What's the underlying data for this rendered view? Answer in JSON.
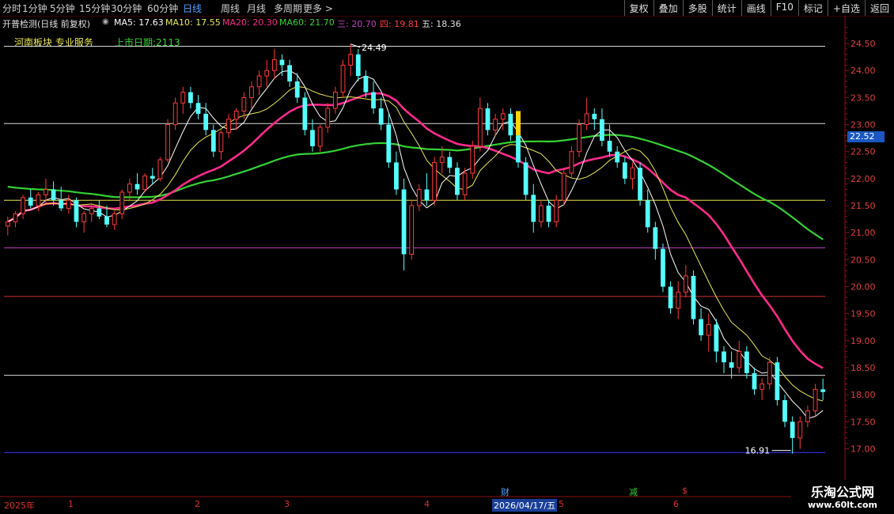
{
  "toolbar": {
    "timeframes": [
      "分时",
      "1分钟",
      "5分钟",
      "15分钟",
      "30分钟",
      "60分钟",
      "日线",
      "周线",
      "月线",
      "多周期",
      "更多 >"
    ],
    "active_timeframe": "日线",
    "right_buttons": [
      "复权",
      "叠加",
      "多股",
      "统计",
      "画线",
      "F10",
      "标记",
      "+自选",
      "返回"
    ]
  },
  "indicator_bar": {
    "name": "开普检测(日线 前复权)",
    "ma5": "MA5: 17.63",
    "ma10": "MA10: 17.55",
    "ma20": "MA20: 20.30",
    "ma60": "MA60: 21.70",
    "san": "三: 20.70",
    "si": "四: 19.81",
    "wu": "五: 18.36"
  },
  "sub_labels": {
    "sector": "河南板块 专业服务",
    "listing": "上市日期:2113"
  },
  "chart_data": {
    "type": "candlestick",
    "ylim": [
      16.7,
      24.75
    ],
    "y_ticks": [
      17.0,
      17.5,
      18.0,
      18.5,
      19.0,
      19.5,
      20.0,
      20.5,
      21.0,
      21.5,
      22.0,
      22.5,
      23.0,
      23.5,
      24.0,
      24.5
    ],
    "y_tick_labels": [
      "17.00",
      "17.50",
      "18.00",
      "18.50",
      "19.00",
      "19.50",
      "20.00",
      "20.50",
      "21.00",
      "21.50",
      "22.00",
      "22.50",
      "23.00",
      "23.50",
      "24.00",
      "24.50"
    ],
    "high_label": "24.49",
    "low_label": "16.91",
    "last_price_label": "22.52",
    "horizontal_lines": [
      {
        "value": 24.45,
        "color": "#d8d8d8"
      },
      {
        "value": 23.02,
        "color": "#d8d8d8"
      },
      {
        "value": 21.6,
        "color": "#e6e64a"
      },
      {
        "value": 20.72,
        "color": "#c040c0"
      },
      {
        "value": 19.82,
        "color": "#d03030"
      },
      {
        "value": 18.36,
        "color": "#d8d8d8"
      },
      {
        "value": 16.93,
        "color": "#3a3aff"
      }
    ],
    "ohlc": [
      [
        21.12,
        21.3,
        20.95,
        21.2
      ],
      [
        21.2,
        21.4,
        21.1,
        21.35
      ],
      [
        21.35,
        21.7,
        21.25,
        21.65
      ],
      [
        21.65,
        21.8,
        21.45,
        21.5
      ],
      [
        21.5,
        21.75,
        21.4,
        21.7
      ],
      [
        21.7,
        22.0,
        21.55,
        21.8
      ],
      [
        21.8,
        21.95,
        21.5,
        21.6
      ],
      [
        21.6,
        21.85,
        21.4,
        21.45
      ],
      [
        21.45,
        21.7,
        21.35,
        21.6
      ],
      [
        21.6,
        21.65,
        21.1,
        21.2
      ],
      [
        21.2,
        21.4,
        21.0,
        21.35
      ],
      [
        21.35,
        21.55,
        21.2,
        21.45
      ],
      [
        21.45,
        21.6,
        21.25,
        21.3
      ],
      [
        21.3,
        21.5,
        21.1,
        21.15
      ],
      [
        21.15,
        21.4,
        21.05,
        21.35
      ],
      [
        21.35,
        21.8,
        21.25,
        21.75
      ],
      [
        21.75,
        22.0,
        21.6,
        21.9
      ],
      [
        21.9,
        22.1,
        21.7,
        21.8
      ],
      [
        21.8,
        22.1,
        21.75,
        22.05
      ],
      [
        22.05,
        22.2,
        21.9,
        22.0
      ],
      [
        22.0,
        22.4,
        21.95,
        22.35
      ],
      [
        22.35,
        23.1,
        22.3,
        23.0
      ],
      [
        23.0,
        23.5,
        22.9,
        23.4
      ],
      [
        23.4,
        23.7,
        23.2,
        23.6
      ],
      [
        23.6,
        23.7,
        23.3,
        23.4
      ],
      [
        23.4,
        23.55,
        23.1,
        23.2
      ],
      [
        23.2,
        23.4,
        22.8,
        22.9
      ],
      [
        22.9,
        23.0,
        22.4,
        22.5
      ],
      [
        22.5,
        22.9,
        22.35,
        22.85
      ],
      [
        22.85,
        23.2,
        22.75,
        23.1
      ],
      [
        23.1,
        23.3,
        22.9,
        23.25
      ],
      [
        23.25,
        23.6,
        23.1,
        23.5
      ],
      [
        23.5,
        23.8,
        23.3,
        23.7
      ],
      [
        23.7,
        24.0,
        23.55,
        23.9
      ],
      [
        23.9,
        24.2,
        23.7,
        24.0
      ],
      [
        24.0,
        24.4,
        23.85,
        24.2
      ],
      [
        24.2,
        24.3,
        23.9,
        24.1
      ],
      [
        24.1,
        24.2,
        23.7,
        23.8
      ],
      [
        23.8,
        23.95,
        23.4,
        23.5
      ],
      [
        23.5,
        23.6,
        22.8,
        22.9
      ],
      [
        22.9,
        23.1,
        22.5,
        22.6
      ],
      [
        22.6,
        23.0,
        22.5,
        22.95
      ],
      [
        22.95,
        23.4,
        22.85,
        23.3
      ],
      [
        23.3,
        23.7,
        23.2,
        23.6
      ],
      [
        23.6,
        24.2,
        23.5,
        24.1
      ],
      [
        24.1,
        24.49,
        23.9,
        24.3
      ],
      [
        24.3,
        24.4,
        23.8,
        23.9
      ],
      [
        23.9,
        24.0,
        23.5,
        23.6
      ],
      [
        23.6,
        23.8,
        23.2,
        23.3
      ],
      [
        23.3,
        23.5,
        22.9,
        23.0
      ],
      [
        23.0,
        23.2,
        22.2,
        22.3
      ],
      [
        22.3,
        22.5,
        21.7,
        21.8
      ],
      [
        21.8,
        22.0,
        20.3,
        20.6
      ],
      [
        20.6,
        21.6,
        20.5,
        21.5
      ],
      [
        21.5,
        21.9,
        21.4,
        21.8
      ],
      [
        21.8,
        22.1,
        21.5,
        21.6
      ],
      [
        21.6,
        22.4,
        21.5,
        22.3
      ],
      [
        22.3,
        22.6,
        22.1,
        22.4
      ],
      [
        22.4,
        22.5,
        22.1,
        22.2
      ],
      [
        22.2,
        22.3,
        21.6,
        21.7
      ],
      [
        21.7,
        22.2,
        21.6,
        22.1
      ],
      [
        22.1,
        22.7,
        22.0,
        22.6
      ],
      [
        22.6,
        23.5,
        22.5,
        23.3
      ],
      [
        23.3,
        23.4,
        22.8,
        22.9
      ],
      [
        22.9,
        23.2,
        22.8,
        23.1
      ],
      [
        23.1,
        23.3,
        22.9,
        23.2
      ],
      [
        23.2,
        23.3,
        22.7,
        22.8
      ],
      [
        22.8,
        22.9,
        22.2,
        22.3
      ],
      [
        22.3,
        22.4,
        21.6,
        21.7
      ],
      [
        21.7,
        21.9,
        21.0,
        21.2
      ],
      [
        21.2,
        21.6,
        21.1,
        21.5
      ],
      [
        21.5,
        21.6,
        21.1,
        21.2
      ],
      [
        21.2,
        21.7,
        21.1,
        21.6
      ],
      [
        21.6,
        22.2,
        21.5,
        22.1
      ],
      [
        22.1,
        22.6,
        22.0,
        22.5
      ],
      [
        22.5,
        23.1,
        22.4,
        23.0
      ],
      [
        23.0,
        23.5,
        22.9,
        23.2
      ],
      [
        23.2,
        23.3,
        22.9,
        23.1
      ],
      [
        23.1,
        23.3,
        22.6,
        22.7
      ],
      [
        22.7,
        23.0,
        22.4,
        22.5
      ],
      [
        22.5,
        22.6,
        22.2,
        22.3
      ],
      [
        22.3,
        22.4,
        21.9,
        22.0
      ],
      [
        22.0,
        22.3,
        21.8,
        22.2
      ],
      [
        22.2,
        22.3,
        21.5,
        21.6
      ],
      [
        21.6,
        21.8,
        21.0,
        21.1
      ],
      [
        21.1,
        21.2,
        20.5,
        20.7
      ],
      [
        20.7,
        20.8,
        19.9,
        20.0
      ],
      [
        20.0,
        20.1,
        19.5,
        19.6
      ],
      [
        19.6,
        20.1,
        19.4,
        19.9
      ],
      [
        19.9,
        20.4,
        19.8,
        20.2
      ],
      [
        20.2,
        20.3,
        19.3,
        19.4
      ],
      [
        19.4,
        19.6,
        19.0,
        19.1
      ],
      [
        19.1,
        19.5,
        18.8,
        19.3
      ],
      [
        19.3,
        19.4,
        18.6,
        18.8
      ],
      [
        18.8,
        18.9,
        18.4,
        18.6
      ],
      [
        18.6,
        18.8,
        18.3,
        18.5
      ],
      [
        18.5,
        19.0,
        18.4,
        18.8
      ],
      [
        18.8,
        18.9,
        18.3,
        18.4
      ],
      [
        18.4,
        18.5,
        18.0,
        18.1
      ],
      [
        18.1,
        18.3,
        17.9,
        18.2
      ],
      [
        18.2,
        18.7,
        18.1,
        18.6
      ],
      [
        18.6,
        18.7,
        17.8,
        17.9
      ],
      [
        17.9,
        18.0,
        17.4,
        17.5
      ],
      [
        17.5,
        17.6,
        16.91,
        17.2
      ],
      [
        17.2,
        17.6,
        17.0,
        17.5
      ],
      [
        17.5,
        17.8,
        17.4,
        17.7
      ],
      [
        17.7,
        18.2,
        17.6,
        18.1
      ],
      [
        18.1,
        18.3,
        17.9,
        18.05
      ]
    ]
  },
  "bottom_axis": {
    "year": "2025年",
    "months": [
      "1",
      "2",
      "3",
      "4",
      "5",
      "6"
    ],
    "date_box": "2026/04/17/五",
    "markers": [
      "财",
      "减",
      "$"
    ]
  },
  "watermark": {
    "line1": "乐淘公式网",
    "line2": "www.60lt.com"
  },
  "colors": {
    "up": "#ff3a3a",
    "down": "#54ffff",
    "ma_white": "#ffffff",
    "ma_yellow": "#e8e850",
    "ma_pink": "#ff2a8a",
    "ma_green": "#34d234"
  }
}
